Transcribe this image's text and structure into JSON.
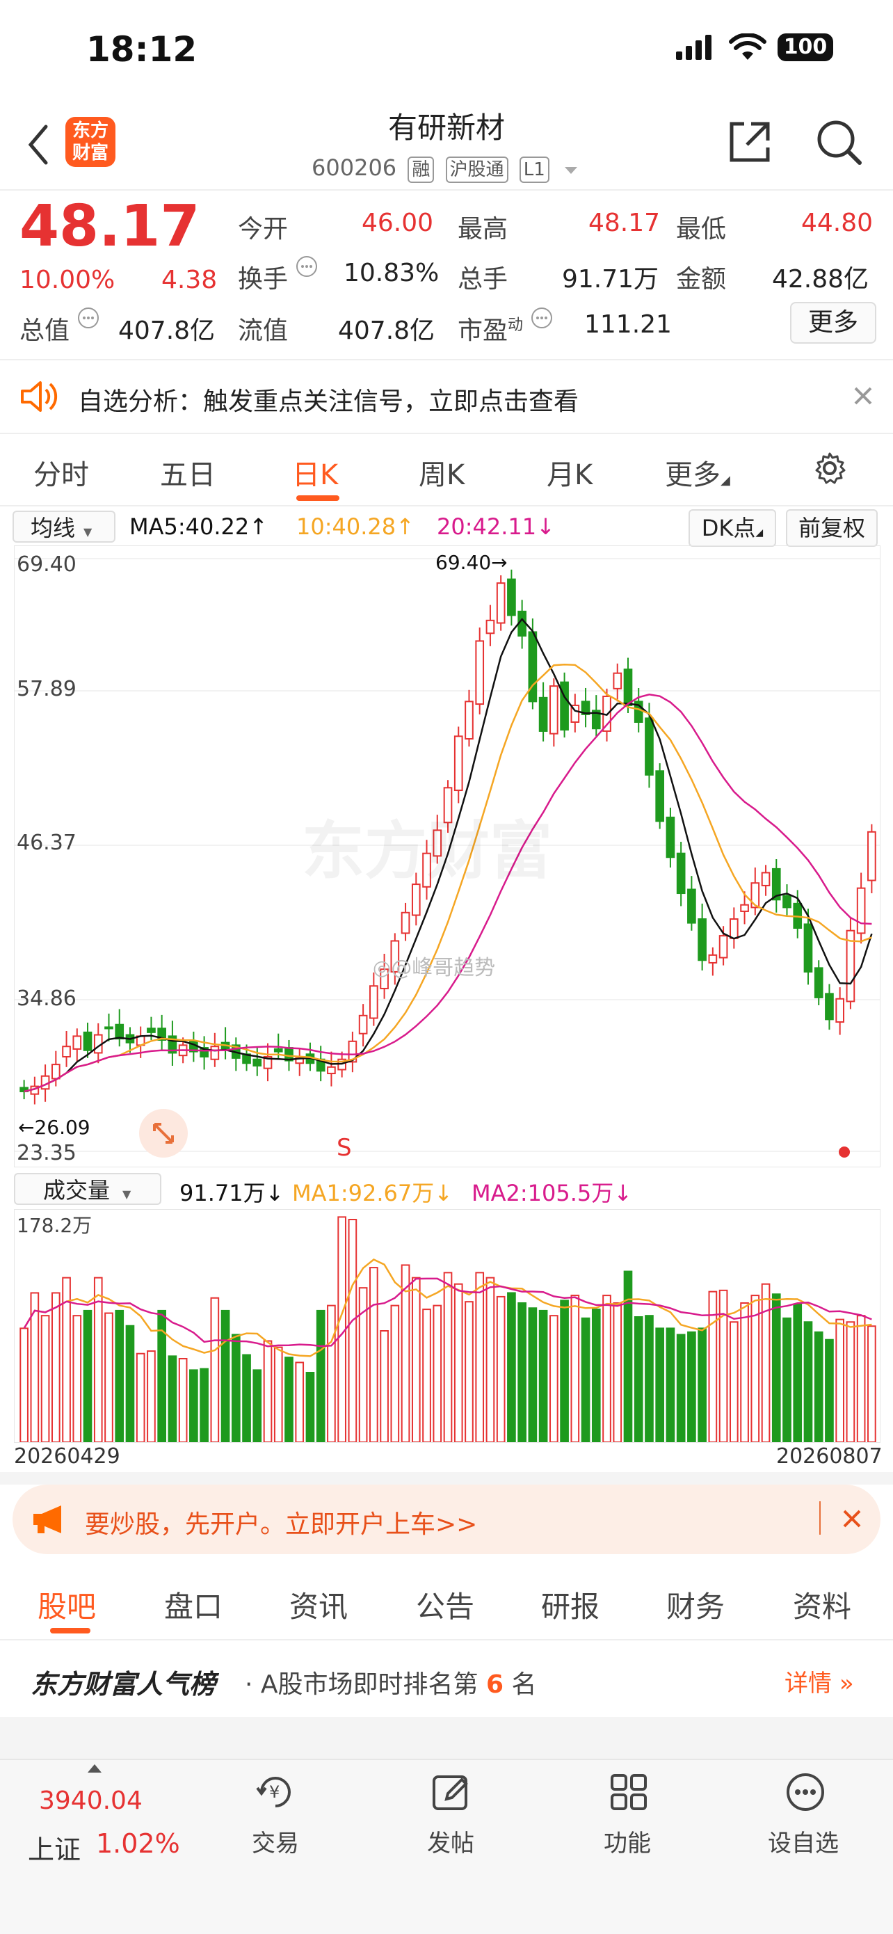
{
  "status_bar": {
    "time": "18:12",
    "battery": "100"
  },
  "header": {
    "logo_line1": "东方",
    "logo_line2": "财富",
    "stock_name": "有研新材",
    "stock_code": "600206",
    "tags": [
      "融",
      "沪股通",
      "L1"
    ]
  },
  "quote": {
    "price": "48.17",
    "change_pct": "10.00%",
    "change": "4.38",
    "open_label": "今开",
    "open": "46.00",
    "high_label": "最高",
    "high": "48.17",
    "low_label": "最低",
    "low": "44.80",
    "turnover_label": "换手",
    "turnover": "10.83%",
    "volume_label": "总手",
    "volume": "91.71万",
    "amount_label": "金额",
    "amount": "42.88亿",
    "mktcap_label": "总值",
    "mktcap": "407.8亿",
    "float_label": "流值",
    "float_cap": "407.8亿",
    "pe_label": "市盈",
    "pe_sup": "动",
    "pe": "111.21",
    "more_label": "更多"
  },
  "analysis_banner": {
    "text": "自选分析：触发重点关注信号，立即点击查看"
  },
  "chart_tabs": [
    "分时",
    "五日",
    "日K",
    "周K",
    "月K",
    "更多"
  ],
  "active_tab": "日K",
  "ma_bar": {
    "selector": "均线",
    "ma5": "MA5:40.22",
    "ma10": "10:40.28",
    "ma20": "20:42.11",
    "dk_label": "DK点",
    "adjust_label": "前复权"
  },
  "colors": {
    "up": "#e63232",
    "down": "#1e9a1e",
    "ma5": "#111111",
    "ma10": "#f5a623",
    "ma20": "#d81b8c",
    "accent": "#ff6a00"
  },
  "chart_data": [
    {
      "type": "candlestick",
      "y_ticks": [
        "69.40",
        "57.89",
        "46.37",
        "34.86",
        "23.35"
      ],
      "ylim": [
        23.35,
        69.4
      ],
      "annotations": {
        "max_label": "69.40→",
        "min_label": "←26.09",
        "signal": "S"
      },
      "watermark": "东方财富",
      "credit": "@峰哥趋势",
      "close": [
        28.0,
        28.4,
        29.2,
        30.1,
        31.5,
        32.3,
        31.2,
        32.4,
        32.9,
        32.1,
        31.8,
        32.3,
        32.6,
        32.0,
        31.0,
        31.6,
        31.1,
        30.7,
        31.5,
        31.3,
        30.6,
        30.2,
        30.0,
        30.7,
        31.1,
        30.4,
        30.6,
        30.2,
        29.6,
        29.9,
        30.5,
        31.9,
        33.9,
        36.2,
        37.5,
        39.7,
        41.9,
        44.1,
        46.5,
        48.3,
        51.6,
        55.6,
        58.3,
        63.0,
        64.6,
        67.5,
        65.0,
        63.4,
        58.3,
        56.0,
        59.5,
        56.1,
        58.0,
        57.3,
        56.2,
        58.7,
        60.5,
        58.0,
        56.7,
        52.6,
        49.0,
        46.2,
        43.4,
        41.1,
        38.2,
        38.6,
        40.1,
        41.4,
        42.5,
        44.2,
        45.0,
        42.9,
        42.3,
        40.7,
        37.3,
        35.3,
        33.6,
        35.2,
        40.5,
        43.8,
        48.17
      ],
      "ma_series": [
        {
          "name": "MA5"
        },
        {
          "name": "MA10"
        },
        {
          "name": "MA20"
        }
      ]
    },
    {
      "type": "bar",
      "title": "成交量",
      "current": "91.71万",
      "ma1": "MA1:92.67万",
      "ma2": "MA2:105.5万",
      "y_max_label": "178.2万",
      "x_start": "20260429",
      "x_end": "20260807",
      "values": [
        90,
        118,
        100,
        118,
        130,
        100,
        104,
        130,
        102,
        104,
        92,
        70,
        72,
        104,
        68,
        66,
        57,
        58,
        114,
        104,
        85,
        69,
        57,
        80,
        75,
        67,
        63,
        55,
        104,
        108,
        178,
        176,
        122,
        138,
        88,
        108,
        140,
        130,
        105,
        108,
        134,
        125,
        111,
        134,
        130,
        115,
        118,
        110,
        106,
        104,
        100,
        112,
        116,
        98,
        105,
        116,
        110,
        135,
        99,
        100,
        90,
        90,
        85,
        87,
        90,
        119,
        120,
        95,
        110,
        116,
        125,
        117,
        98,
        109,
        95,
        87,
        81,
        97,
        95,
        100,
        91.71
      ]
    }
  ],
  "promo_banner": {
    "text": "要炒股，先开户。立即开户上车>>"
  },
  "bottom_tabs": [
    "股吧",
    "盘口",
    "资讯",
    "公告",
    "研报",
    "财务",
    "资料"
  ],
  "active_bottom_tab": "股吧",
  "ranking": {
    "title": "东方财富人气榜",
    "text_prefix": "· A股市场即时排名第",
    "rank": "6",
    "text_suffix": "名",
    "detail": "详情"
  },
  "bottom_nav": {
    "index_value": "3940.04",
    "index_name": "上证",
    "index_change": "1.02%",
    "items": [
      {
        "label": "交易",
        "icon": "yuan-cycle-icon"
      },
      {
        "label": "发帖",
        "icon": "edit-icon"
      },
      {
        "label": "功能",
        "icon": "grid-icon"
      },
      {
        "label": "设自选",
        "icon": "more-circle-icon"
      }
    ]
  }
}
